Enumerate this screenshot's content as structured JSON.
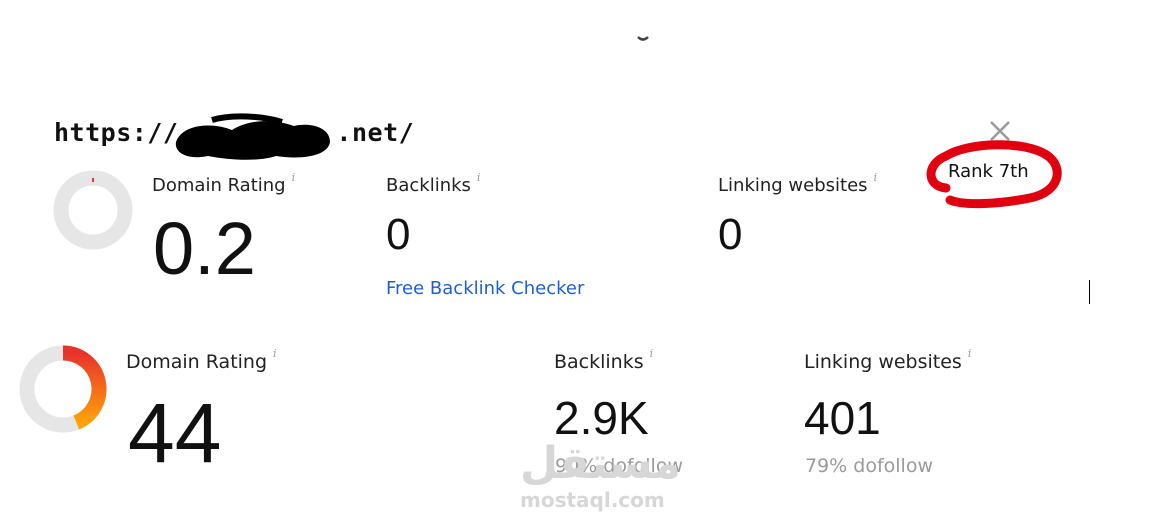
{
  "site": {
    "url_prefix": "https://",
    "url_suffix": ".net/"
  },
  "rank_note": "Rank 7th",
  "top_panel": {
    "domain_rating": {
      "label": "Domain Rating",
      "info": "i",
      "value": "0.2",
      "ring_fraction": 0.002
    },
    "backlinks": {
      "label": "Backlinks",
      "info": "i",
      "value": "0",
      "link": "Free Backlink Checker"
    },
    "linking_websites": {
      "label": "Linking websites",
      "info": "i",
      "value": "0"
    }
  },
  "bottom_panel": {
    "domain_rating": {
      "label": "Domain Rating",
      "info": "i",
      "value": "44",
      "ring_fraction": 0.44
    },
    "backlinks": {
      "label": "Backlinks",
      "info": "i",
      "value": "2.9K",
      "sub": "90% dofollow"
    },
    "linking_websites": {
      "label": "Linking websites",
      "info": "i",
      "value": "401",
      "sub": "79% dofollow"
    }
  },
  "watermark": {
    "script": "مستقل",
    "text": "mostaql.com"
  },
  "colors": {
    "ring_track": "#e6e6e6",
    "ring_start": "#e8322c",
    "ring_end": "#ffa30a",
    "link": "#1f5fd1",
    "annotation_red": "#e0000f"
  }
}
